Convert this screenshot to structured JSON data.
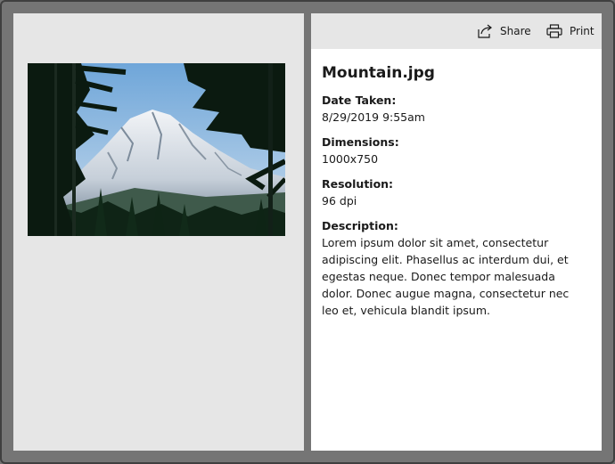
{
  "toolbar": {
    "share_label": "Share",
    "print_label": "Print",
    "share_icon": "share-icon",
    "print_icon": "printer-icon"
  },
  "image": {
    "description": "photo-thumbnail"
  },
  "details": {
    "file_name": "Mountain.jpg",
    "date_taken_label": "Date Taken:",
    "date_taken_value": "8/29/2019 9:55am",
    "dimensions_label": "Dimensions:",
    "dimensions_value": "1000x750",
    "resolution_label": "Resolution:",
    "resolution_value": "96 dpi",
    "description_label": "Description:",
    "description_value": "Lorem ipsum dolor sit amet, consectetur adipiscing elit. Phasellus ac interdum dui, et egestas neque. Donec tempor malesuada dolor. Donec augue magna, consectetur nec leo et, vehicula blandit ipsum."
  },
  "colors": {
    "frame": "#757575",
    "pane_background": "#e6e6e6",
    "details_background": "#ffffff",
    "text": "#1a1a1a"
  }
}
